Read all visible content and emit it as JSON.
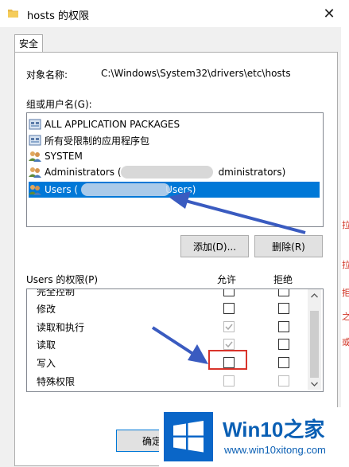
{
  "window": {
    "title": "hosts 的权限",
    "close_glyph": "✕"
  },
  "tabs": [
    {
      "label": "安全"
    }
  ],
  "object": {
    "label": "对象名称:",
    "value": "C:\\Windows\\System32\\drivers\\etc\\hosts"
  },
  "groups": {
    "label": "组或用户名(G):",
    "items": [
      {
        "name": "ALL APPLICATION PACKAGES",
        "icon": "package-group-icon"
      },
      {
        "name": "所有受限制的应用程序包",
        "icon": "package-group-icon"
      },
      {
        "name": "SYSTEM",
        "icon": "user-group-icon"
      },
      {
        "name_start": "Administrators (",
        "name_end": "dministrators)",
        "icon": "user-group-icon"
      },
      {
        "name_start": "Users (",
        "name_end": "Users)",
        "icon": "user-group-icon",
        "selected": true
      }
    ]
  },
  "buttons": {
    "add": "添加(D)...",
    "remove": "删除(R)",
    "ok": "确定"
  },
  "permissions": {
    "header": "Users 的权限(P)",
    "allow_label": "允许",
    "deny_label": "拒绝",
    "rows": [
      {
        "name": "完全控制",
        "allow": false,
        "deny": false,
        "allow_disabled": false,
        "deny_disabled": false
      },
      {
        "name": "修改",
        "allow": false,
        "deny": false,
        "allow_disabled": false,
        "deny_disabled": false
      },
      {
        "name": "读取和执行",
        "allow": true,
        "deny": false,
        "allow_disabled": true,
        "deny_disabled": false
      },
      {
        "name": "读取",
        "allow": true,
        "deny": false,
        "allow_disabled": true,
        "deny_disabled": false
      },
      {
        "name": "写入",
        "allow": false,
        "deny": false,
        "allow_disabled": false,
        "deny_disabled": false
      },
      {
        "name": "特殊权限",
        "allow": false,
        "deny": false,
        "allow_disabled": true,
        "deny_disabled": true
      }
    ]
  },
  "watermark": {
    "brand": "Win10",
    "brand_suffix": "之家",
    "url": "www.win10xitong.com"
  },
  "colors": {
    "accent": "#0078d7",
    "annotation": "#3a5bc0",
    "highlight_box": "#d9342b"
  }
}
